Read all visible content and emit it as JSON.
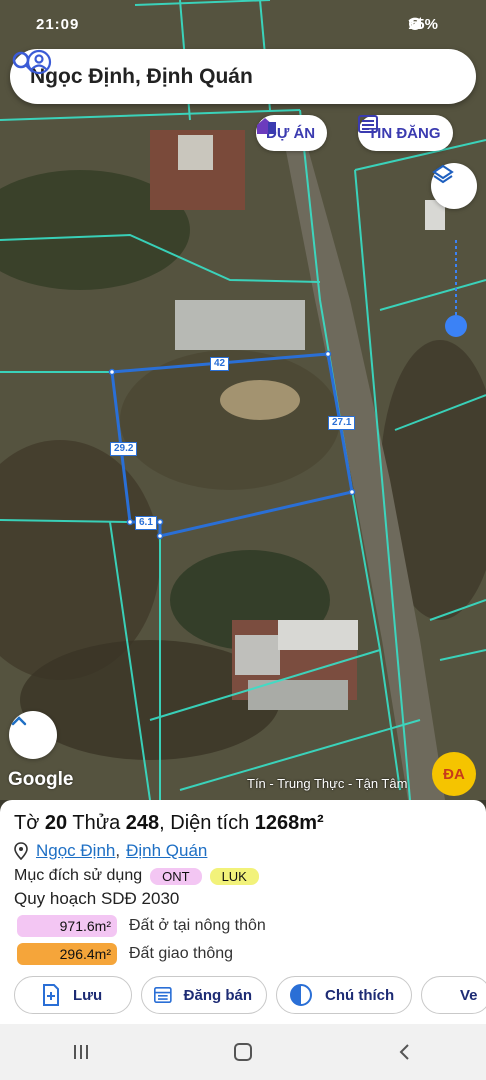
{
  "status_bar": {
    "time": "21:09",
    "battery": "15%"
  },
  "search": {
    "query": "Ngọc Định, Định Quán"
  },
  "chips": {
    "project": "DỰ ÁN",
    "listing": "TIN ĐĂNG"
  },
  "map": {
    "edge_labels": {
      "top": "42",
      "right": "27.1",
      "left": "29.2",
      "bottom": "6.1"
    },
    "google": "Google",
    "watermark": "Tín - Trung Thực - Tận Tâm",
    "logo_text": "ĐA"
  },
  "parcel": {
    "sheet_prefix": "Tờ",
    "sheet_no": "20",
    "parcel_prefix": "Thửa",
    "parcel_no": "248",
    "area_prefix": ", Diện tích",
    "area": "1268m²",
    "commune": "Ngọc Định",
    "district": "Định Quán",
    "purpose_label": "Mục đích sử dụng",
    "purpose_tags": [
      "ONT",
      "LUK"
    ],
    "plan_title": "Quy hoạch SDĐ 2030",
    "plan_rows": [
      {
        "area": "971.6m²",
        "label": "Đất ở tại nông thôn",
        "color": "#f3c6f3"
      },
      {
        "area": "296.4m²",
        "label": "Đất giao thông",
        "color": "#f5a53a"
      }
    ]
  },
  "actions": {
    "save": "Lưu",
    "post": "Đăng bán",
    "legend": "Chú thích",
    "more": "Ve"
  },
  "colors": {
    "accent": "#3b3bb0",
    "parcel_line": "#2a6fd6",
    "tag_ont": "#f3c6f3",
    "tag_luk": "#f2f27a"
  }
}
